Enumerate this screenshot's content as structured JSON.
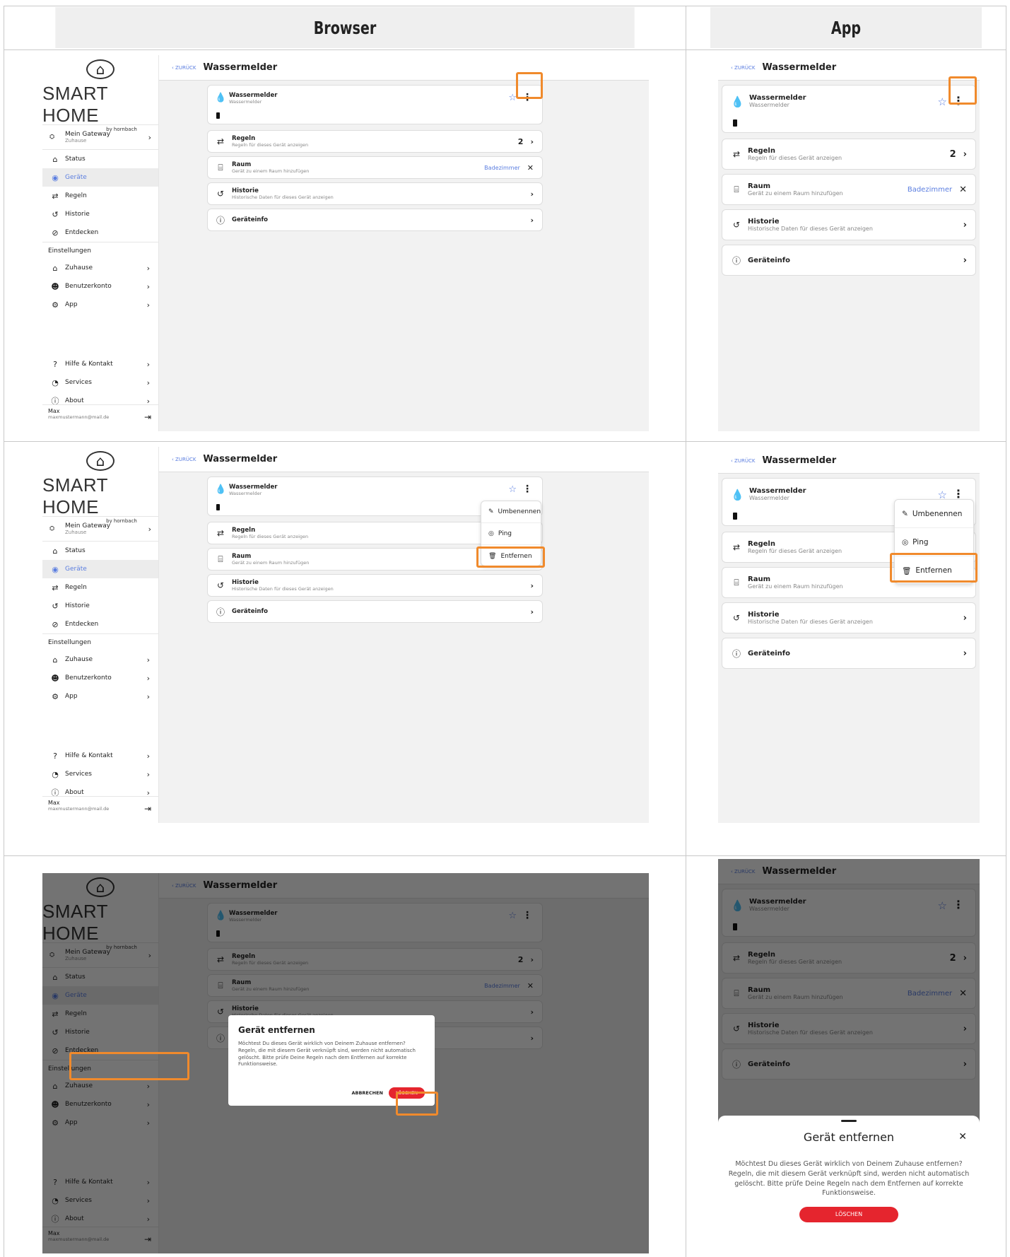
{
  "columns": {
    "browser": "Browser",
    "app": "App"
  },
  "sidebar": {
    "brand": "SMART HOME",
    "by": "by hornbach",
    "gateway_title": "Mein Gateway",
    "gateway_sub": "Zuhause",
    "items": [
      "Status",
      "Geräte",
      "Regeln",
      "Historie",
      "Entdecken"
    ],
    "settings_label": "Einstellungen",
    "settings_items": [
      "Zuhause",
      "Benutzerkonto",
      "App"
    ],
    "help_items": [
      "Hilfe & Kontakt",
      "Services",
      "About"
    ],
    "user_name": "Max",
    "user_mail": "maxmustermann@mail.de"
  },
  "page": {
    "back": "ZURÜCK",
    "title": "Wassermelder",
    "device_name": "Wassermelder",
    "device_sub": "Wassermelder",
    "rules_title": "Regeln",
    "rules_sub": "Regeln für dieses Gerät anzeigen",
    "rules_count": "2",
    "room_title": "Raum",
    "room_sub": "Gerät zu einem Raum hinzufügen",
    "room_value": "Badezimmer",
    "history_title": "Historie",
    "history_sub": "Historische Daten für dieses Gerät anzeigen",
    "info_title": "Geräteinfo"
  },
  "menu": {
    "rename": "Umbenennen",
    "ping": "Ping",
    "remove": "Entfernen"
  },
  "dialog": {
    "title": "Gerät entfernen",
    "text": "Möchtest Du dieses Gerät wirklich von Deinem Zuhause entfernen? Regeln, die mit diesem Gerät verknüpft sind, werden nicht automatisch gelöscht. Bitte prüfe Deine Regeln nach dem Entfernen auf korrekte Funktionsweise.",
    "cancel": "ABBRECHEN",
    "delete": "LÖSCHEN"
  },
  "colors": {
    "accent": "#5b7ee0",
    "highlight": "#f08a2c",
    "danger": "#e5252e"
  }
}
